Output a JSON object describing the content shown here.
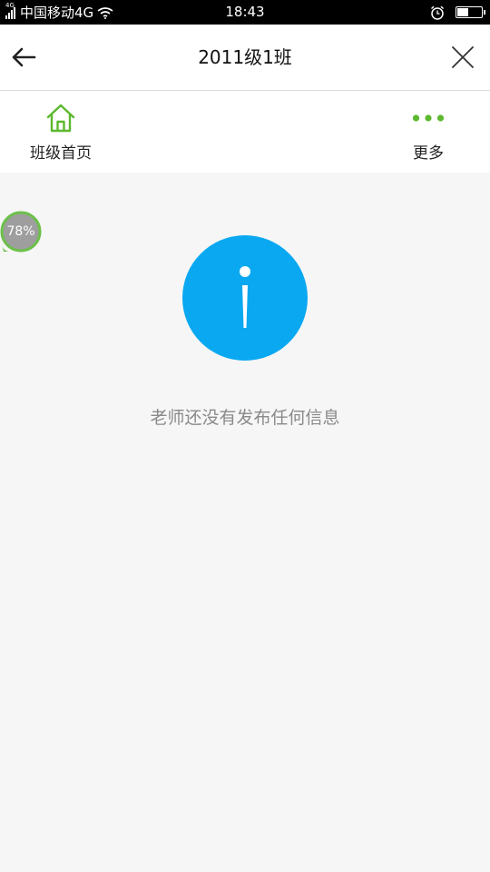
{
  "status_bar": {
    "network_tag": "4G",
    "carrier": "中国移动4G",
    "time": "18:43",
    "battery_level": 0.5
  },
  "header": {
    "title": "2011级1班",
    "back_icon": "arrow-left-icon",
    "close_icon": "close-icon"
  },
  "tabs": [
    {
      "label": "班级首页",
      "icon": "home-icon"
    },
    {
      "label": "更多",
      "icon": "more-dots-icon"
    }
  ],
  "content": {
    "empty_message": "老师还没有发布任何信息",
    "icon": "info-icon"
  },
  "floating_badge": {
    "text": "78%"
  },
  "colors": {
    "accent_green": "#5cb82e",
    "info_blue": "#0aa8f1",
    "background": "#f6f6f6"
  }
}
